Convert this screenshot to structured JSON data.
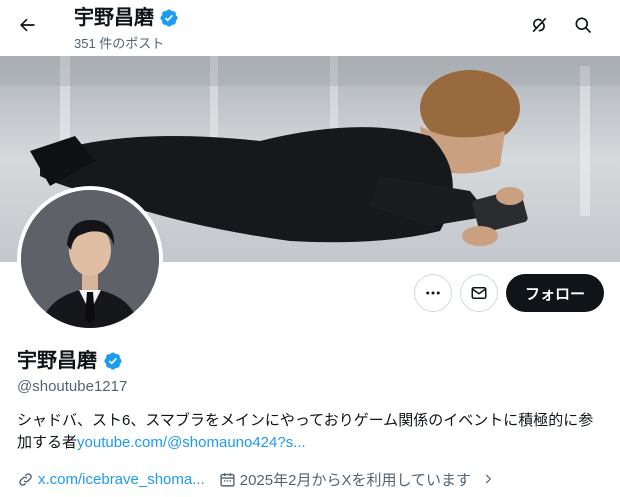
{
  "header": {
    "name": "宇野昌磨",
    "post_count": "351 件のポスト"
  },
  "profile": {
    "name": "宇野昌磨",
    "handle": "@shoutube1217",
    "bio_text": "シャドバ、スト6、スマブラをメインにやっておりゲーム関係のイベントに積極的に参加する者",
    "bio_link": "youtube.com/@shomauno424?s...",
    "website": "x.com/icebrave_shoma...",
    "joined": "2025年2月からXを利用しています"
  },
  "actions": {
    "follow_label": "フォロー"
  },
  "icons": {
    "back": "arrow-left-icon",
    "grok": "grok-icon",
    "search": "search-icon",
    "verified": "verified-badge-icon",
    "more": "more-dots-icon",
    "message": "mail-icon",
    "link": "link-icon",
    "calendar": "calendar-icon",
    "chevron": "chevron-right-icon"
  },
  "colors": {
    "accent": "#1d9bf0",
    "text_primary": "#0f1419",
    "text_secondary": "#536471",
    "follow_bg": "#0f1419"
  }
}
